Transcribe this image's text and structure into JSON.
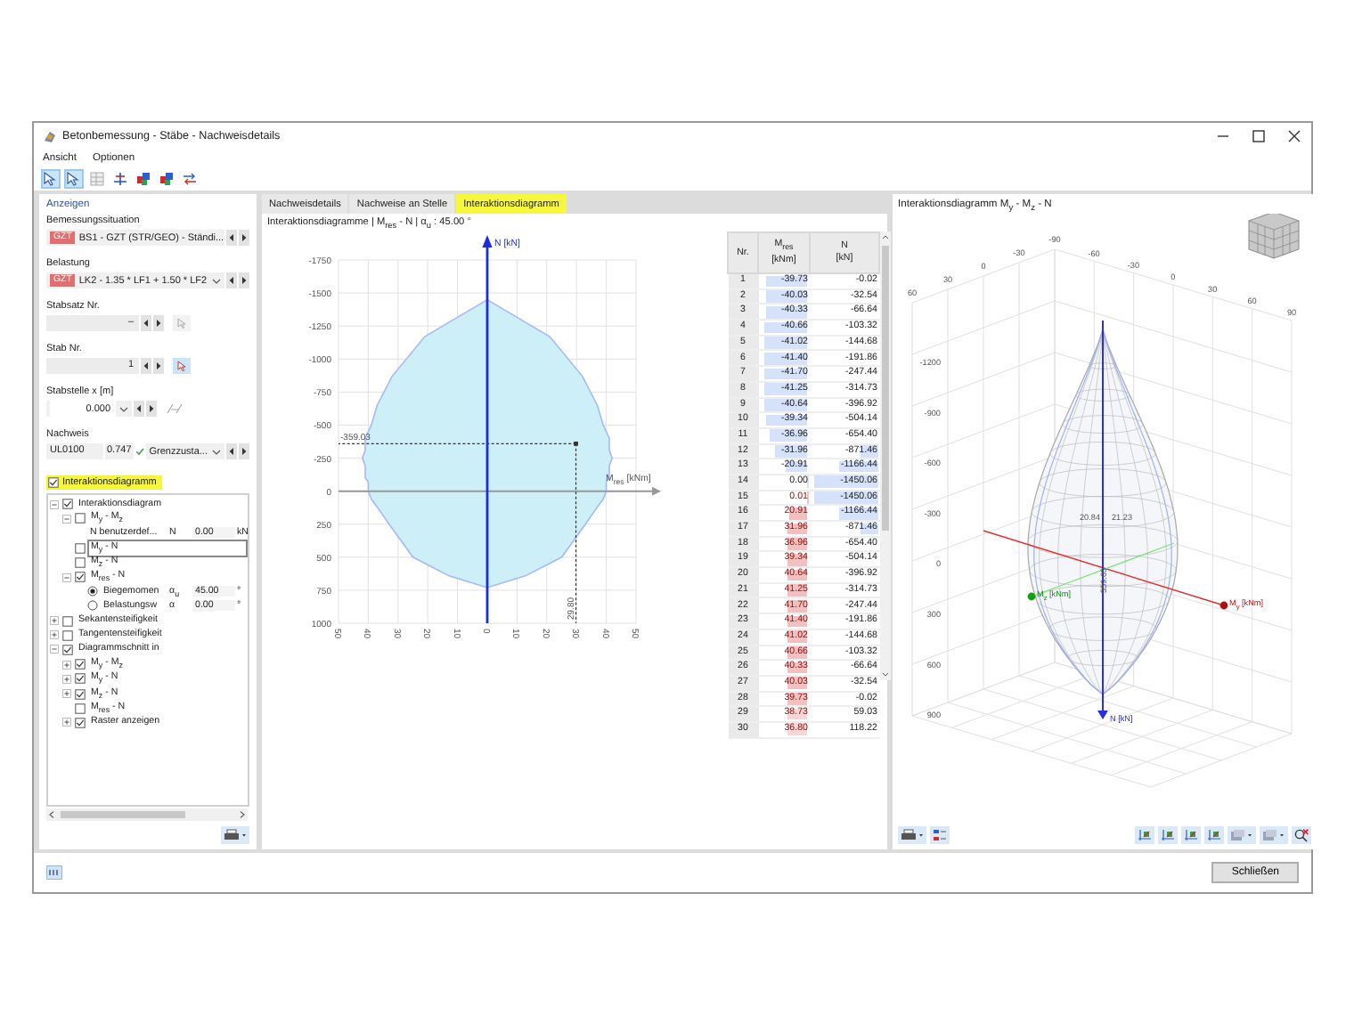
{
  "window": {
    "title": "Betonbemessung - Stäbe - Nachweisdetails"
  },
  "menu": [
    "Ansicht",
    "Optionen"
  ],
  "toolbar": [
    {
      "kind": "select",
      "on": true
    },
    {
      "kind": "select",
      "on": true
    },
    {
      "kind": "table",
      "on": false
    },
    {
      "kind": "axes",
      "on": false
    },
    {
      "kind": "cubes",
      "on": false
    },
    {
      "kind": "cubes",
      "on": false
    },
    {
      "kind": "swap",
      "on": false
    }
  ],
  "panel": {
    "title": "Anzeigen",
    "fields": [
      {
        "label": "Bemessungssituation",
        "kind": "tagged-select",
        "tag": "GZT",
        "value": "BS1 - GZT (STR/GEO) - Ständi..."
      },
      {
        "label": "Belastung",
        "kind": "tagged-select",
        "tag": "GZT",
        "value": "LK2 - 1.35 * LF1 + 1.50 * LF2"
      },
      {
        "label": "Stabsatz Nr.",
        "kind": "spin",
        "value": "–",
        "pick_on": false
      },
      {
        "label": "Stab Nr.",
        "kind": "spin",
        "value": "1",
        "pick_on": true
      },
      {
        "label": "Stabstelle x [m]",
        "kind": "select-spin",
        "value": "0.000"
      },
      {
        "label": "Nachweis",
        "kind": "check",
        "code": "UL0100",
        "ratio": "0.747",
        "value": "Grenzzusta..."
      }
    ]
  },
  "diagram_toggle": {
    "label": "Interaktionsdiagramm",
    "checked": true
  },
  "tree": [
    {
      "kind": "check",
      "label": "Interaktionsdiagram",
      "checked": true,
      "expanded": true,
      "focused": false,
      "children": [
        {
          "kind": "check",
          "label": "M$_{y}$ - M$_{z}$",
          "checked": false,
          "expanded": true,
          "focused": false,
          "children": [
            {
              "kind": "value",
              "label": "N benutzerdef...",
              "symbol": "N",
              "value": "0.00",
              "unit": "kN",
              "focused": false
            }
          ]
        },
        {
          "kind": "check",
          "label": "M$_{y}$ - N",
          "checked": false,
          "focused": true
        },
        {
          "kind": "check",
          "label": "M$_{z}$ - N",
          "checked": false,
          "focused": false
        },
        {
          "kind": "check",
          "label": "M$_{res}$ - N",
          "checked": true,
          "expanded": true,
          "focused": false,
          "children": [
            {
              "kind": "radio",
              "label": "Biegemomen",
              "symbol": "α$_{u}$",
              "value": "45.00",
              "unit": "°",
              "selected": true,
              "focused": false
            },
            {
              "kind": "radio",
              "label": "Belastungsw",
              "symbol": "α",
              "value": "0.00",
              "unit": "°",
              "selected": false,
              "focused": false
            }
          ]
        }
      ]
    },
    {
      "kind": "check",
      "label": "Sekantensteifigkeit",
      "checked": false,
      "expanded": false,
      "focused": false
    },
    {
      "kind": "check",
      "label": "Tangentensteifigkeit",
      "checked": false,
      "expanded": false,
      "focused": false
    },
    {
      "kind": "check",
      "label": "Diagrammschnitt in",
      "checked": true,
      "expanded": true,
      "focused": false,
      "children": [
        {
          "kind": "check",
          "label": "M$_{y}$ - M$_{z}$",
          "checked": true,
          "expanded": false,
          "focused": false
        },
        {
          "kind": "check",
          "label": "M$_{y}$ - N",
          "checked": true,
          "expanded": false,
          "focused": false
        },
        {
          "kind": "check",
          "label": "M$_{z}$ - N",
          "checked": true,
          "expanded": false,
          "focused": false
        },
        {
          "kind": "check",
          "label": "M$_{res}$ - N",
          "checked": false,
          "focused": false
        },
        {
          "kind": "check",
          "label": "Raster anzeigen",
          "checked": true,
          "expanded": false,
          "focused": false
        }
      ]
    }
  ],
  "tabs": [
    {
      "label": "Nachweisdetails",
      "selected": false
    },
    {
      "label": "Nachweise an Stelle",
      "selected": false
    },
    {
      "label": "Interaktionsdiagramm",
      "selected": true
    }
  ],
  "chart_caption": "Interaktionsdiagramme | M$_{res}$ - N | α$_{u}$ : 45.00 °",
  "chart": {
    "chart_data": {
      "type": "area",
      "xlabel": "M$_{res}$ [kNm]",
      "ylabel": "N [kN]",
      "x": [
        -40,
        -40,
        -40,
        -41,
        -41,
        -41,
        -42,
        -41,
        -41,
        -39,
        -37,
        -32,
        -21,
        0,
        0,
        21,
        32,
        37,
        39,
        41,
        41,
        42,
        41,
        41,
        41,
        40,
        40,
        40,
        39,
        37,
        33,
        25,
        13,
        0,
        -13,
        -25,
        -33,
        -37,
        -39,
        -40
      ],
      "series": [
        {
          "color": "#a8b8f8",
          "values": [
            0,
            -30,
            -70,
            -100,
            -140,
            -190,
            -250,
            -310,
            -400,
            -500,
            -650,
            -870,
            -1170,
            -1450,
            -1450,
            -1170,
            -870,
            -650,
            -500,
            -400,
            -310,
            -250,
            -190,
            -140,
            -100,
            -70,
            -30,
            0,
            60,
            120,
            250,
            500,
            640,
            730,
            640,
            500,
            250,
            120,
            60,
            0
          ]
        }
      ],
      "grid": true,
      "ref_lines": [
        {
          "axis": "x",
          "value": 0,
          "color": "#1a2ee0"
        },
        {
          "axis": "y",
          "value": -359.03
        },
        {
          "axis": "x",
          "value": 29.8
        }
      ],
      "xlim": [
        -50,
        50
      ],
      "ylim": [
        1000,
        -1750
      ],
      "xticks": [
        {
          "value": -50,
          "label": "50"
        },
        {
          "value": -40,
          "label": "40"
        },
        {
          "value": -30,
          "label": "30"
        },
        {
          "value": -20,
          "label": "20"
        },
        {
          "value": -10,
          "label": "10"
        },
        {
          "value": 0,
          "label": "0"
        },
        {
          "value": 10,
          "label": "10"
        },
        {
          "value": 20,
          "label": "20"
        },
        {
          "value": 30,
          "label": "30"
        },
        {
          "value": 40,
          "label": "40"
        },
        {
          "value": 50,
          "label": "50"
        }
      ],
      "yticks": [
        -1750,
        -1500,
        -1250,
        -1000,
        -750,
        -500,
        -250,
        0,
        250,
        500,
        750,
        1000
      ],
      "annotations": [
        "-359.03",
        "29.80"
      ]
    }
  },
  "table": {
    "columns": [
      {
        "name": "Nr."
      },
      {
        "name": "M$_{res}$",
        "unit": "[kNm]"
      },
      {
        "name": "N",
        "unit": "[kN]"
      }
    ],
    "rows": [
      {
        "nr": "1",
        "m": {
          "text": "-39.73",
          "level": 0.81,
          "color": "#d6e1fa"
        },
        "n": {
          "text": "-0.02"
        }
      },
      {
        "nr": "2",
        "m": {
          "text": "-40.03",
          "level": 0.82,
          "color": "#d6e1fa"
        },
        "n": {
          "text": "-32.54"
        }
      },
      {
        "nr": "3",
        "m": {
          "text": "-40.33",
          "level": 0.82,
          "color": "#d6e1fa"
        },
        "n": {
          "text": "-66.64"
        }
      },
      {
        "nr": "4",
        "m": {
          "text": "-40.66",
          "level": 0.83,
          "color": "#d6e1fa"
        },
        "n": {
          "text": "-103.32"
        }
      },
      {
        "nr": "5",
        "m": {
          "text": "-41.02",
          "level": 0.84,
          "color": "#d6e1fa"
        },
        "n": {
          "text": "-144.68"
        }
      },
      {
        "nr": "6",
        "m": {
          "text": "-41.40",
          "level": 0.84,
          "color": "#d6e1fa"
        },
        "n": {
          "text": "-191.86"
        }
      },
      {
        "nr": "7",
        "m": {
          "text": "-41.70",
          "level": 0.85,
          "color": "#d6e1fa"
        },
        "n": {
          "text": "-247.44"
        }
      },
      {
        "nr": "8",
        "m": {
          "text": "-41.25",
          "level": 0.84,
          "color": "#d6e1fa"
        },
        "n": {
          "text": "-314.73"
        }
      },
      {
        "nr": "9",
        "m": {
          "text": "-40.64",
          "level": 0.83,
          "color": "#d6e1fa"
        },
        "n": {
          "text": "-396.92"
        }
      },
      {
        "nr": "10",
        "m": {
          "text": "-39.34",
          "level": 0.8,
          "color": "#d6e1fa"
        },
        "n": {
          "text": "-504.14"
        }
      },
      {
        "nr": "11",
        "m": {
          "text": "-36.96",
          "level": 0.75,
          "color": "#d6e1fa"
        },
        "n": {
          "text": "-654.40"
        }
      },
      {
        "nr": "12",
        "m": {
          "text": "-31.96",
          "level": 0.65,
          "color": "#d6e1fa"
        },
        "n": {
          "text": "-871.46",
          "level": 0.25
        }
      },
      {
        "nr": "13",
        "m": {
          "text": "-20.91",
          "level": 0.43,
          "color": "#d6e1fa"
        },
        "n": {
          "text": "-1166.44",
          "level": 0.55
        }
      },
      {
        "nr": "14",
        "m": {
          "text": "0.00",
          "level": 0.02,
          "color": "#d6e1fa"
        },
        "n": {
          "text": "-1450.06",
          "level": 0.9
        }
      },
      {
        "nr": "15",
        "m": {
          "text": "0.01",
          "level": 0.02,
          "color": "#f3c0c0"
        },
        "n": {
          "text": "-1450.06",
          "level": 0.9
        }
      },
      {
        "nr": "16",
        "m": {
          "text": "20.91",
          "level": 0.35,
          "color": "#f3c0c0"
        },
        "n": {
          "text": "-1166.44",
          "level": 0.55
        }
      },
      {
        "nr": "17",
        "m": {
          "text": "31.96",
          "level": 0.4,
          "color": "#f3c0c0"
        },
        "n": {
          "text": "-871.46",
          "level": 0.25
        }
      },
      {
        "nr": "18",
        "m": {
          "text": "36.96",
          "level": 0.4,
          "color": "#f3c0c0"
        },
        "n": {
          "text": "-654.40"
        }
      },
      {
        "nr": "19",
        "m": {
          "text": "39.34",
          "level": 0.4,
          "color": "#f3c0c0"
        },
        "n": {
          "text": "-504.14"
        }
      },
      {
        "nr": "20",
        "m": {
          "text": "40.64",
          "level": 0.4,
          "color": "#f3c0c0"
        },
        "n": {
          "text": "-396.92"
        }
      },
      {
        "nr": "21",
        "m": {
          "text": "41.25",
          "level": 0.4,
          "color": "#f3c0c0"
        },
        "n": {
          "text": "-314.73"
        }
      },
      {
        "nr": "22",
        "m": {
          "text": "41.70",
          "level": 0.4,
          "color": "#f3c0c0"
        },
        "n": {
          "text": "-247.44"
        }
      },
      {
        "nr": "23",
        "m": {
          "text": "41.40",
          "level": 0.4,
          "color": "#f3c0c0"
        },
        "n": {
          "text": "-191.86"
        }
      },
      {
        "nr": "24",
        "m": {
          "text": "41.02",
          "level": 0.4,
          "color": "#f3c0c0"
        },
        "n": {
          "text": "-144.68"
        }
      },
      {
        "nr": "25",
        "m": {
          "text": "40.66",
          "level": 0.4,
          "color": "#f3c0c0"
        },
        "n": {
          "text": "-103.32"
        }
      },
      {
        "nr": "26",
        "m": {
          "text": "40.33",
          "level": 0.4,
          "color": "#f3c0c0"
        },
        "n": {
          "text": "-66.64"
        }
      },
      {
        "nr": "27",
        "m": {
          "text": "40.03",
          "level": 0.4,
          "color": "#f3c0c0"
        },
        "n": {
          "text": "-32.54"
        }
      },
      {
        "nr": "28",
        "m": {
          "text": "39.73",
          "level": 0.4,
          "color": "#f3c0c0"
        },
        "n": {
          "text": "-0.02"
        }
      },
      {
        "nr": "29",
        "m": {
          "text": "38.73",
          "level": 0.4,
          "color": "#f8d6d6"
        },
        "n": {
          "text": "59.03"
        }
      },
      {
        "nr": "30",
        "m": {
          "text": "36.80",
          "level": 0.4,
          "color": "#f8d6d6"
        },
        "n": {
          "text": "118.22"
        }
      }
    ]
  },
  "view3d": {
    "title": "Interaktionsdiagramm M$_{y}$ - M$_{z}$ - N",
    "left_ticks": [
      "60",
      "30",
      "0",
      "-30",
      "-90"
    ],
    "right_ticks": [
      "-60",
      "-30",
      "0",
      "30",
      "60",
      "90"
    ],
    "n_ticks": [
      "-1200",
      "-900",
      "-600",
      "-300",
      "0",
      "300",
      "600",
      "900"
    ],
    "surface_labels": [
      "20.84",
      "21.23"
    ],
    "axis_value": "359.03",
    "axes": {
      "my": "M$_{y}$ [kNm]",
      "mz": "M$_{z}$ [kNm]",
      "n": "N [kN]"
    }
  },
  "footer": {
    "button": "Schließen"
  }
}
